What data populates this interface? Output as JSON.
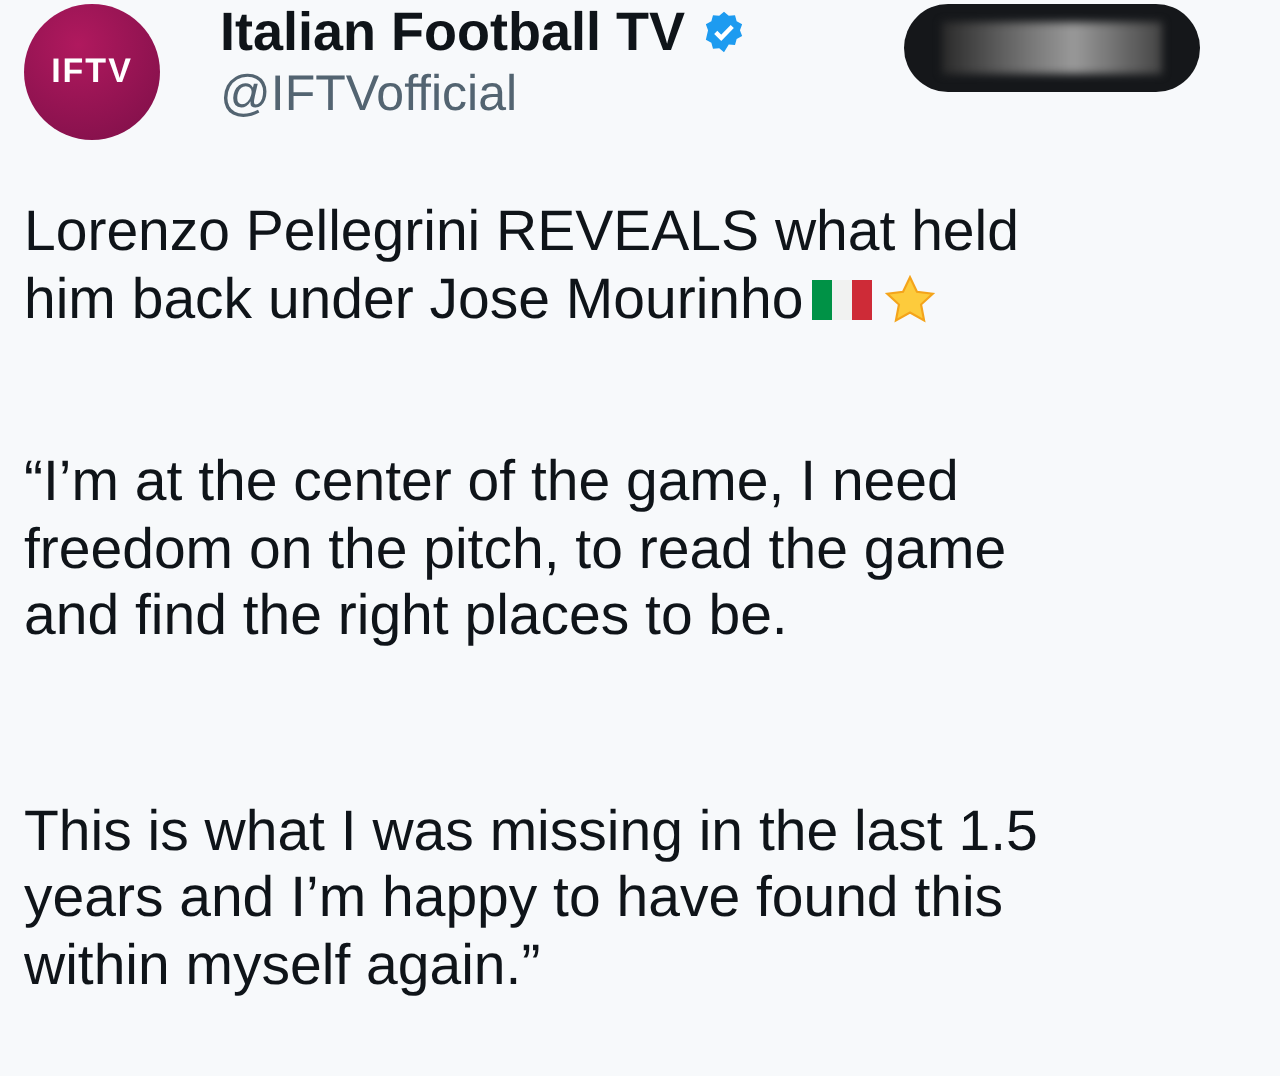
{
  "author": {
    "avatar_text": "IFTV",
    "name": "Italian Football TV",
    "verified": true,
    "handle": "@IFTVofficial"
  },
  "paragraphs": [
    {
      "lines": [
        "Lorenzo Pellegrini REVEALS what held",
        "him back under Jose Mourinho"
      ],
      "trailing_emoji": true
    },
    {
      "lines": [
        "“I’m at the center of the game, I need",
        "freedom on the pitch, to read the game",
        "and find the right places to be."
      ],
      "trailing_emoji": false
    },
    {
      "lines": [
        "This is what I was missing in the last 1.5",
        "years and I’m happy to have found this",
        "within myself again.”"
      ],
      "trailing_emoji": false
    }
  ]
}
